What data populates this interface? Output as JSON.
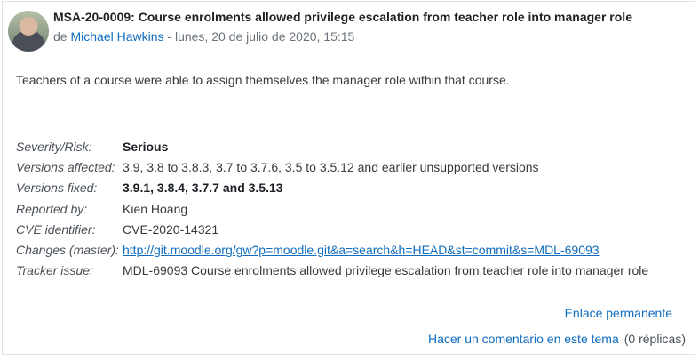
{
  "post": {
    "title": "MSA-20-0009: Course enrolments allowed privilege escalation from teacher role into manager role",
    "byline_prefix": "de",
    "author": "Michael Hawkins",
    "date": "- lunes, 20 de julio de 2020, 15:15",
    "summary": "Teachers of a course were able to assign themselves the manager role within that course."
  },
  "details": [
    {
      "label": "Severity/Risk:",
      "value": "Serious"
    },
    {
      "label": "Versions affected:",
      "value": "3.9, 3.8 to 3.8.3, 3.7 to 3.7.6, 3.5 to 3.5.12 and earlier unsupported versions"
    },
    {
      "label": "Versions fixed:",
      "value": "3.9.1, 3.8.4, 3.7.7 and 3.5.13"
    },
    {
      "label": "Reported by:",
      "value": "Kien Hoang"
    },
    {
      "label": "CVE identifier:",
      "value": "CVE-2020-14321"
    },
    {
      "label": "Changes (master):",
      "value": "http://git.moodle.org/gw?p=moodle.git&a=search&h=HEAD&st=commit&s=MDL-69093"
    },
    {
      "label": "Tracker issue:",
      "value": "MDL-69093 Course enrolments allowed privilege escalation from teacher role into manager role"
    }
  ],
  "footer": {
    "permalink": "Enlace permanente",
    "reply": "Hacer un comentario en este tema",
    "reply_count": "(0 réplicas)"
  },
  "colors": {
    "link": "#0f6cbf",
    "border": "#dee2e6"
  }
}
